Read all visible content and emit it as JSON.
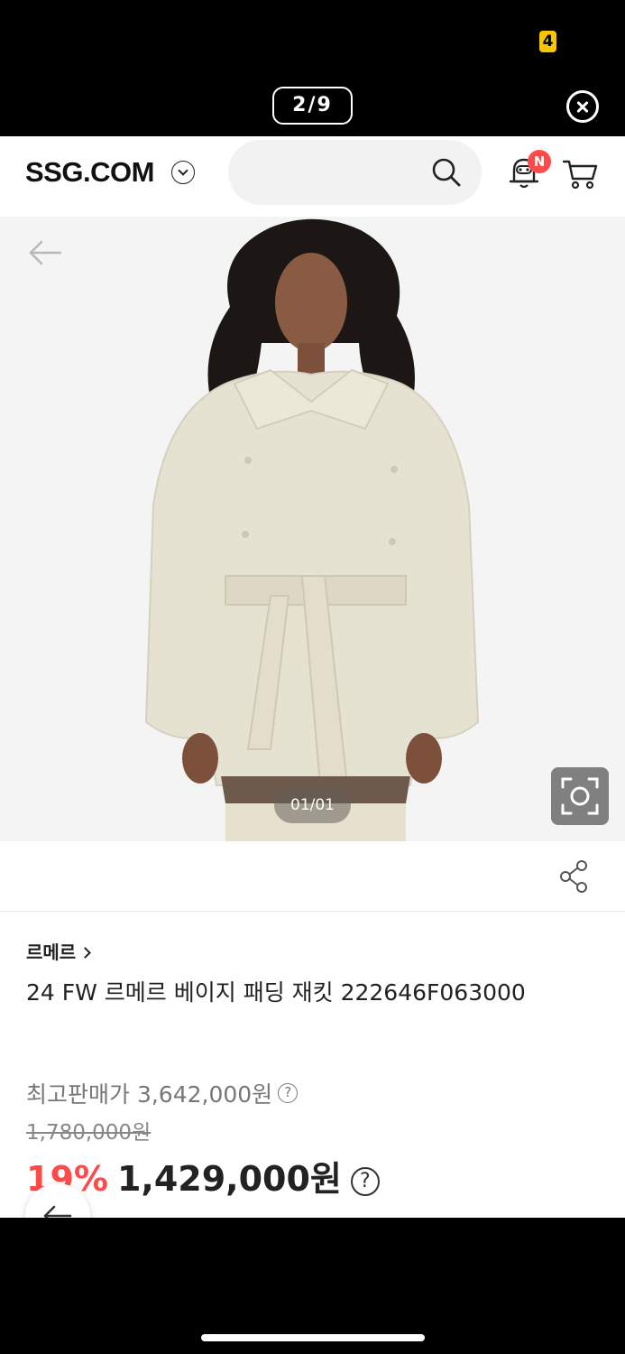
{
  "viewer": {
    "status_badge": "4",
    "page_counter": "2/9",
    "close_icon": "close-circle-icon"
  },
  "header": {
    "logo": "SSG.COM",
    "logo_dropdown_icon": "chevron-down-icon",
    "search_placeholder": "",
    "search_icon": "search-icon",
    "notification_badge": "N",
    "cart_icon": "cart-icon"
  },
  "gallery": {
    "image_counter": "01/01",
    "back_icon": "arrow-left-icon",
    "lens_icon": "camera-lens-icon",
    "image_alt": "product photo of beige padded jacket"
  },
  "product": {
    "brand": "르메르",
    "title": "24 FW 르메르 베이지 패딩 재킷 222646F063000",
    "max_price_label": "최고판매가 3,642,000원",
    "original_price": "1,780,000원",
    "discount": "19%",
    "sale_price": "1,429,000원",
    "help_icon": "?"
  },
  "colors": {
    "accent_red": "#ff4a4a",
    "badge_yellow": "#f7c600"
  }
}
